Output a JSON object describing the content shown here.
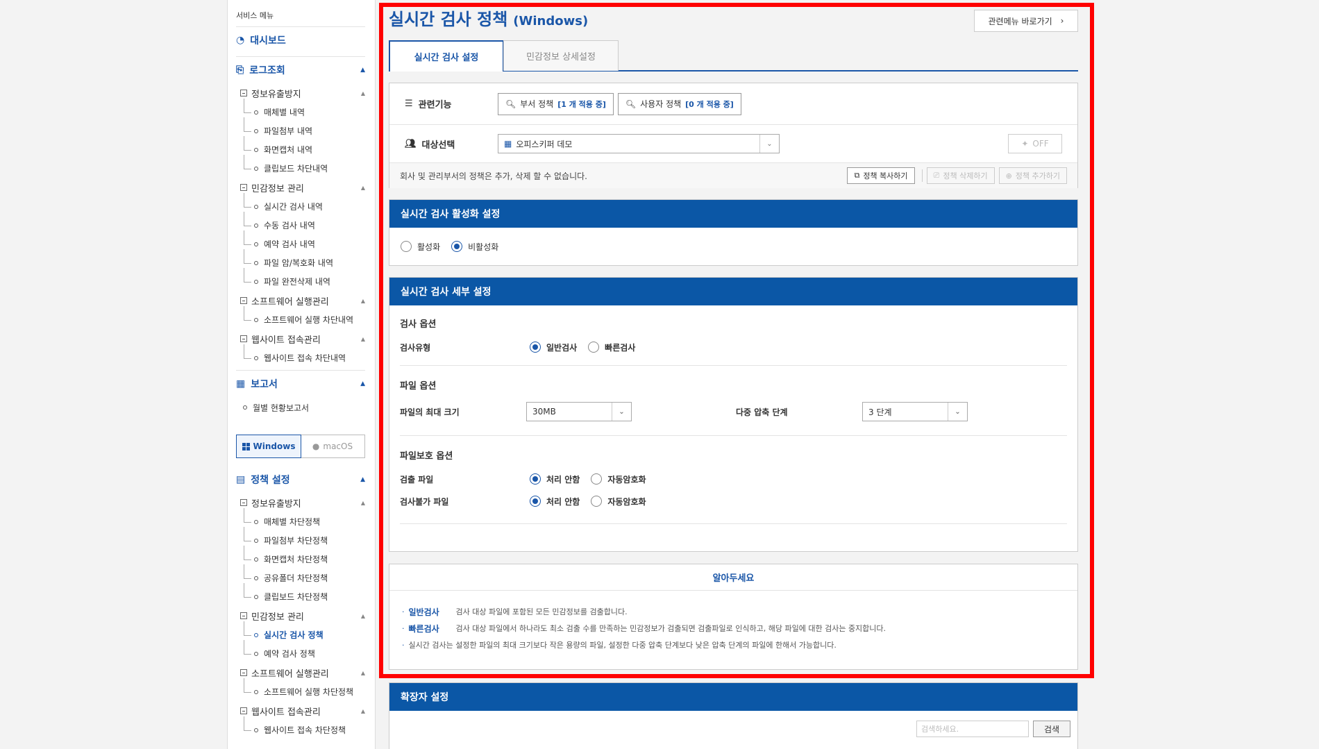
{
  "sidebar": {
    "service_label": "서비스 메뉴",
    "dashboard": "대시보드",
    "log": {
      "title": "로그조회",
      "groups": [
        {
          "title": "정보유출방지",
          "items": [
            "매체별 내역",
            "파일첨부 내역",
            "화면캡처 내역",
            "클립보드 차단내역"
          ]
        },
        {
          "title": "민감정보 관리",
          "items": [
            "실시간 검사 내역",
            "수동 검사 내역",
            "예약 검사 내역",
            "파일 암/복호화 내역",
            "파일 완전삭제 내역"
          ]
        },
        {
          "title": "소프트웨어 실행관리",
          "items": [
            "소프트웨어 실행 차단내역"
          ]
        },
        {
          "title": "웹사이트 접속관리",
          "items": [
            "웹사이트 접속 차단내역"
          ]
        }
      ]
    },
    "report": {
      "title": "보고서",
      "items": [
        "월별 현황보고서"
      ]
    },
    "os_tabs": {
      "windows": "Windows",
      "mac": "macOS"
    },
    "policy": {
      "title": "정책 설정",
      "groups": [
        {
          "title": "정보유출방지",
          "items": [
            "매체별 차단정책",
            "파일첨부 차단정책",
            "화면캡처 차단정책",
            "공유폴더 차단정책",
            "클립보드 차단정책"
          ]
        },
        {
          "title": "민감정보 관리",
          "items": [
            "실시간 검사 정책",
            "예약 검사 정책"
          ]
        },
        {
          "title": "소프트웨어 실행관리",
          "items": [
            "소프트웨어 실행 차단정책"
          ]
        },
        {
          "title": "웹사이트 접속관리",
          "items": [
            "웹사이트 접속 차단정책"
          ]
        }
      ]
    }
  },
  "header": {
    "title": "실시간 검사 정책",
    "subtitle": "(Windows)",
    "goto_label": "관련메뉴 바로가기"
  },
  "tabs": [
    "실시간 검사 설정",
    "민감정보 상세설정"
  ],
  "related": {
    "label": "관련기능",
    "dept_policy": "부서 정책",
    "dept_count": "[1 개 적용 중]",
    "user_policy": "사용자 정책",
    "user_count": "[0 개 적용 중]"
  },
  "target": {
    "label": "대상선택",
    "value": "오피스키퍼 데모",
    "toggle": "OFF"
  },
  "note": {
    "text": "회사 및 관리부서의 정책은 추가, 삭제 할 수 없습니다.",
    "copy": "정책 복사하기",
    "delete": "정책 삭제하기",
    "add": "정책 추가하기"
  },
  "activation": {
    "title": "실시간 검사 활성화 설정",
    "on": "활성화",
    "off": "비활성화",
    "selected": "off"
  },
  "detail": {
    "title": "실시간 검사 세부 설정",
    "scan_options": "검사 옵션",
    "scan_type_label": "검사유형",
    "scan_type_normal": "일반검사",
    "scan_type_fast": "빠른검사",
    "file_options": "파일 옵션",
    "max_size_label": "파일의 최대 크기",
    "max_size_value": "30MB",
    "compress_label": "다중 압축 단계",
    "compress_value": "3 단계",
    "protect_options": "파일보호 옵션",
    "detected_label": "검출 파일",
    "unscannable_label": "검사불가 파일",
    "no_action": "처리 안함",
    "auto_encrypt": "자동암호화"
  },
  "notice": {
    "title": "알아두세요",
    "normal_kw": "일반검사",
    "normal_text": "검사 대상 파일에 포함된 모든 민감정보를 검출합니다.",
    "fast_kw": "빠른검사",
    "fast_text": "검사 대상 파일에서 하나라도 최소 검출 수를 만족하는 민감정보가 검출되면 검출파일로 인식하고, 해당 파일에 대한 검사는 중지합니다.",
    "extra_text": "실시간 검사는 설정한 파일의 최대 크기보다 작은 용량의 파일, 설정한 다중 압축 단계보다 낮은 압축 단계의 파일에 한해서 가능합니다."
  },
  "extension": {
    "title": "확장자 설정",
    "search_placeholder": "검색하세요.",
    "search_button": "검색"
  },
  "colors": {
    "accent": "#1a56a8",
    "header_bg": "#0b57a6",
    "highlight": "#ff0000"
  }
}
